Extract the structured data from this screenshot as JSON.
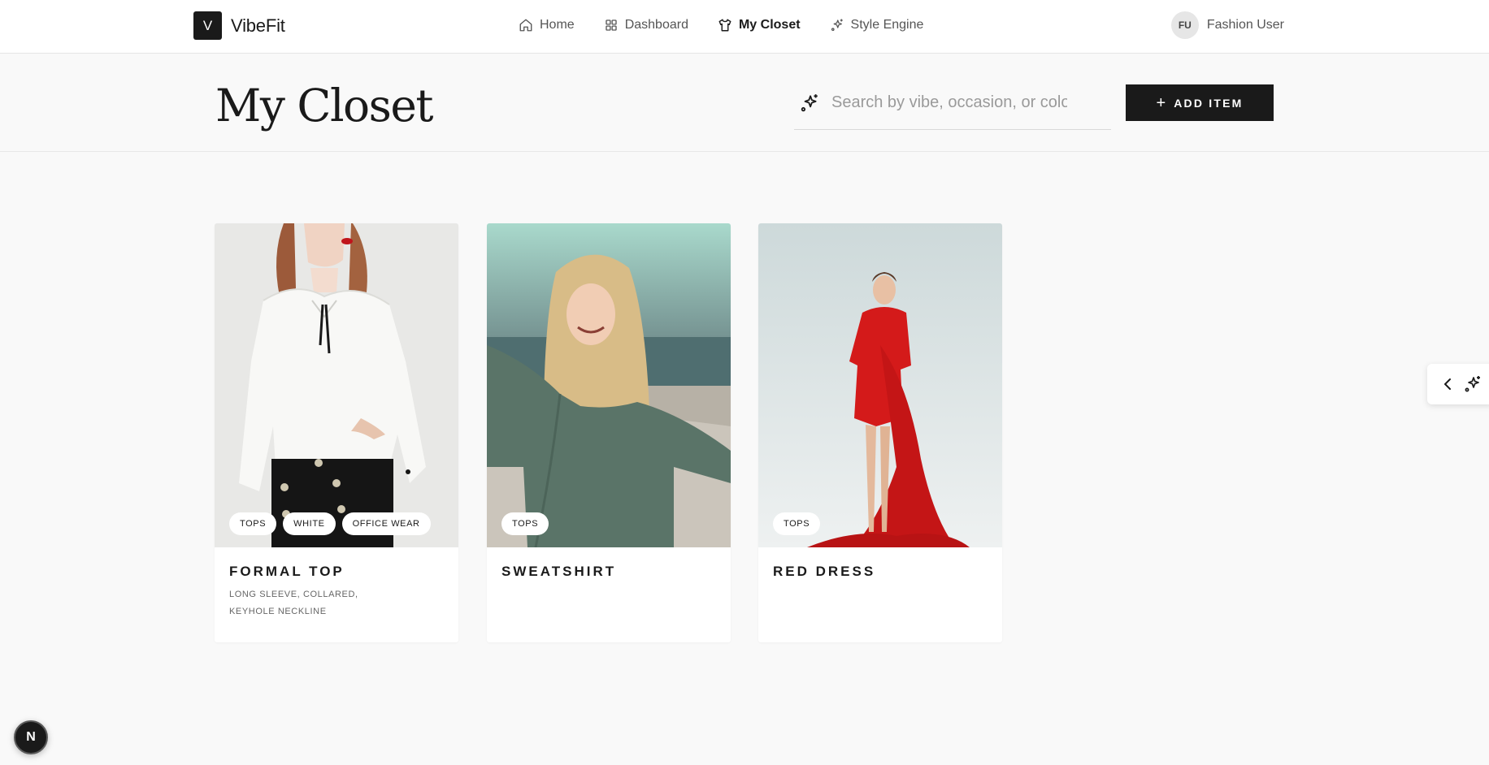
{
  "brand": {
    "mark": "V",
    "name": "VibeFit"
  },
  "nav": {
    "items": [
      {
        "label": "Home",
        "icon": "home-icon"
      },
      {
        "label": "Dashboard",
        "icon": "dashboard-grid-icon"
      },
      {
        "label": "My Closet",
        "icon": "shirt-icon",
        "active": true
      },
      {
        "label": "Style Engine",
        "icon": "sparkles-icon"
      }
    ]
  },
  "user": {
    "initials": "FU",
    "name": "Fashion User"
  },
  "header": {
    "title": "My Closet",
    "search_placeholder": "Search by vibe, occasion, or color...",
    "add_plus": "+",
    "add_label": "ADD ITEM"
  },
  "cards": [
    {
      "title": "FORMAL TOP",
      "desc": "LONG SLEEVE, COLLARED, KEYHOLE NECKLINE",
      "tags": [
        "TOPS",
        "WHITE",
        "OFFICE WEAR"
      ]
    },
    {
      "title": "SWEATSHIRT",
      "desc": "",
      "tags": [
        "TOPS"
      ]
    },
    {
      "title": "RED DRESS",
      "desc": "",
      "tags": [
        "TOPS"
      ]
    }
  ],
  "side_tab": {
    "icons": [
      "chevron-left-icon",
      "sparkles-icon"
    ]
  },
  "dev_badge": {
    "label": "N"
  },
  "colors": {
    "accent": "#1a1a1a",
    "background": "#f9f9f9",
    "surface": "#ffffff",
    "muted_text": "#555555",
    "dress_red": "#d41a1a"
  }
}
